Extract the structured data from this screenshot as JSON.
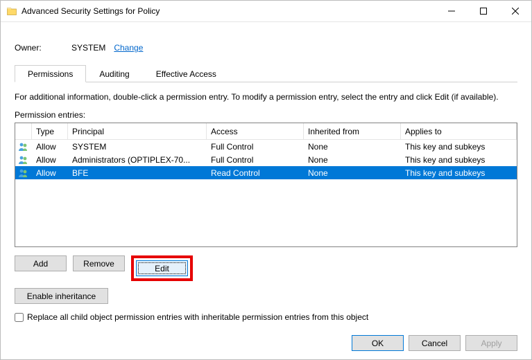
{
  "window": {
    "title": "Advanced Security Settings for Policy"
  },
  "owner": {
    "label": "Owner:",
    "value": "SYSTEM",
    "change_link": "Change"
  },
  "tabs": {
    "permissions": "Permissions",
    "auditing": "Auditing",
    "effective": "Effective Access"
  },
  "info_text": "For additional information, double-click a permission entry. To modify a permission entry, select the entry and click Edit (if available).",
  "entries_label": "Permission entries:",
  "columns": {
    "type": "Type",
    "principal": "Principal",
    "access": "Access",
    "inherited": "Inherited from",
    "applies": "Applies to"
  },
  "rows": [
    {
      "type": "Allow",
      "principal": "SYSTEM",
      "access": "Full Control",
      "inherited": "None",
      "applies": "This key and subkeys",
      "selected": false
    },
    {
      "type": "Allow",
      "principal": "Administrators (OPTIPLEX-70...",
      "access": "Full Control",
      "inherited": "None",
      "applies": "This key and subkeys",
      "selected": false
    },
    {
      "type": "Allow",
      "principal": "BFE",
      "access": "Read Control",
      "inherited": "None",
      "applies": "This key and subkeys",
      "selected": true
    }
  ],
  "buttons": {
    "add": "Add",
    "remove": "Remove",
    "edit": "Edit",
    "enable_inheritance": "Enable inheritance",
    "ok": "OK",
    "cancel": "Cancel",
    "apply": "Apply"
  },
  "replace_checkbox": "Replace all child object permission entries with inheritable permission entries from this object"
}
